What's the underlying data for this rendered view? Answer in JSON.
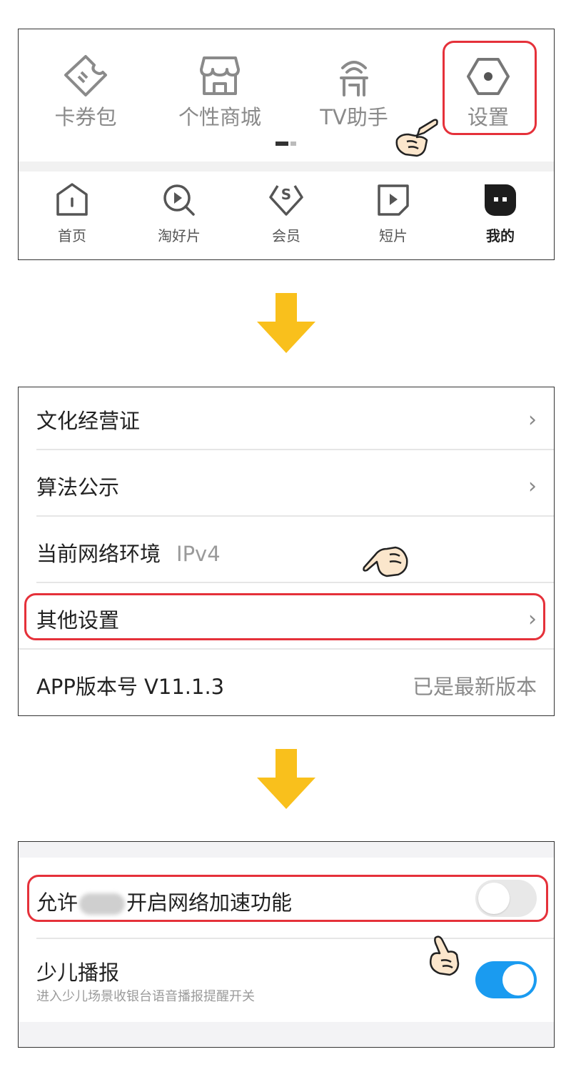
{
  "panel1": {
    "shortcuts": [
      {
        "label": "卡券包",
        "icon": "ticket-icon"
      },
      {
        "label": "个性商城",
        "icon": "store-icon"
      },
      {
        "label": "TV助手",
        "icon": "tv-remote-icon"
      },
      {
        "label": "设置",
        "icon": "settings-hexagon-icon"
      }
    ],
    "tabs": [
      {
        "label": "首页",
        "icon": "home-icon"
      },
      {
        "label": "淘好片",
        "icon": "search-play-icon"
      },
      {
        "label": "会员",
        "icon": "vip-diamond-icon"
      },
      {
        "label": "短片",
        "icon": "short-video-icon"
      },
      {
        "label": "我的",
        "icon": "profile-icon",
        "active": true
      }
    ]
  },
  "panel2": {
    "rows": [
      {
        "label": "文化经营证",
        "chevron": "›"
      },
      {
        "label": "算法公示",
        "chevron": "›"
      },
      {
        "label": "当前网络环境",
        "value": "IPv4"
      },
      {
        "label": "其他设置",
        "chevron": "›"
      },
      {
        "label": "APP版本号 V11.1.3",
        "right": "已是最新版本"
      }
    ]
  },
  "panel3": {
    "acceleration": {
      "label_before": "允许",
      "label_after": "开启网络加速功能",
      "enabled": false
    },
    "kids": {
      "title": "少儿播报",
      "subtitle": "进入少儿场景收银台语音播报提醒开关",
      "enabled": true
    }
  },
  "colors": {
    "highlight": "#e5313a",
    "arrow": "#f9c01c",
    "toggle_on": "#1a9bf0",
    "toggle_off": "#e8e8e8"
  }
}
